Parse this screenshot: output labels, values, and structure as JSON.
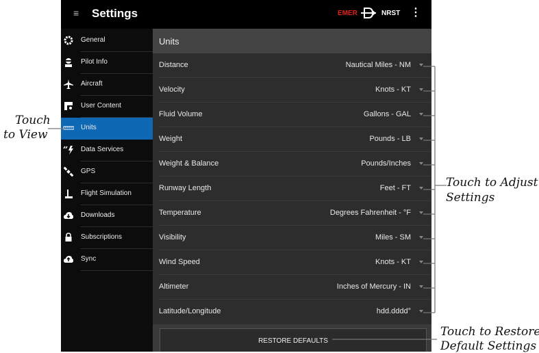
{
  "header": {
    "title": "Settings",
    "menu_icon": "hamburger-icon",
    "emer_label": "EMER",
    "direct_to_icon": "direct-to-icon",
    "nrst_label": "NRST",
    "overflow_icon": "kebab-menu-icon",
    "emer_color": "#e0201c"
  },
  "sidebar": {
    "items": [
      {
        "label": "General",
        "icon": "gear-icon"
      },
      {
        "label": "Pilot Info",
        "icon": "pilot-icon"
      },
      {
        "label": "Aircraft",
        "icon": "airplane-icon"
      },
      {
        "label": "User Content",
        "icon": "user-content-icon"
      },
      {
        "label": "Units",
        "icon": "ruler-icon",
        "active": true
      },
      {
        "label": "Data Services",
        "icon": "data-services-icon"
      },
      {
        "label": "GPS",
        "icon": "satellite-icon"
      },
      {
        "label": "Flight Simulation",
        "icon": "joystick-icon"
      },
      {
        "label": "Downloads",
        "icon": "cloud-download-icon"
      },
      {
        "label": "Subscriptions",
        "icon": "lock-icon"
      },
      {
        "label": "Sync",
        "icon": "cloud-sync-icon"
      }
    ],
    "active_color": "#0f68b4"
  },
  "units": {
    "section_title": "Units",
    "rows": [
      {
        "label": "Distance",
        "value": "Nautical Miles - NM"
      },
      {
        "label": "Velocity",
        "value": "Knots - KT"
      },
      {
        "label": "Fluid Volume",
        "value": "Gallons - GAL"
      },
      {
        "label": "Weight",
        "value": "Pounds - LB"
      },
      {
        "label": "Weight & Balance",
        "value": "Pounds/Inches"
      },
      {
        "label": "Runway Length",
        "value": "Feet - FT"
      },
      {
        "label": "Temperature",
        "value": "Degrees Fahrenheit - °F"
      },
      {
        "label": "Visibility",
        "value": "Miles - SM"
      },
      {
        "label": "Wind Speed",
        "value": "Knots - KT"
      },
      {
        "label": "Altimeter",
        "value": "Inches of Mercury - IN"
      },
      {
        "label": "Latitude/Longitude",
        "value": "hdd.dddd°"
      }
    ],
    "restore_label": "RESTORE DEFAULTS"
  },
  "annotations": {
    "touch_to_view_1": "Touch",
    "touch_to_view_2": "to View",
    "adjust_1": "Touch to Adjust",
    "adjust_2": "Settings",
    "restore_1": "Touch to Restore",
    "restore_2": "Default Settings"
  }
}
